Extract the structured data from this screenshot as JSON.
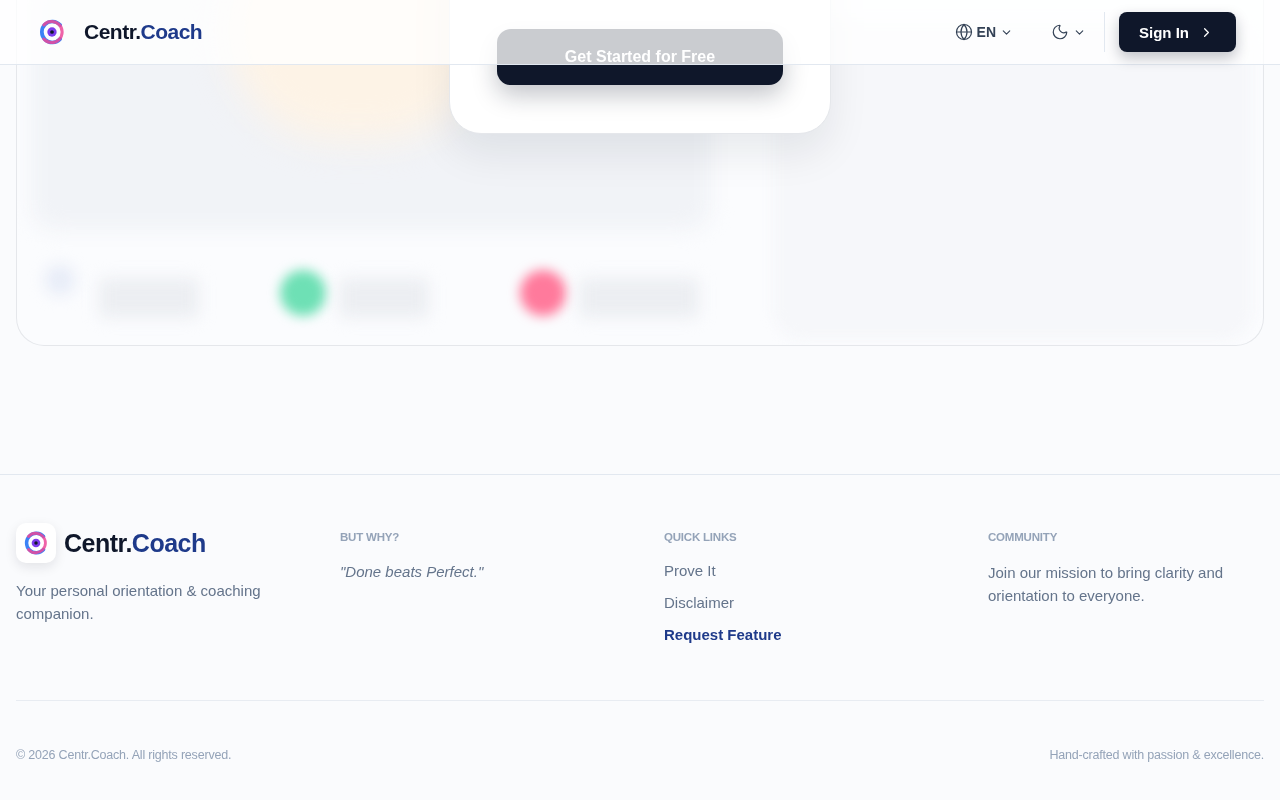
{
  "header": {
    "brand": {
      "prefix": "Centr.",
      "suffix": "Coach"
    },
    "language": "EN",
    "dark_mode": false,
    "sign_in": "Sign In"
  },
  "hero": {
    "cta": "Get Started for Free"
  },
  "footer": {
    "brand": {
      "prefix": "Centr.",
      "suffix": "Coach"
    },
    "tagline": "Your personal orientation & coaching companion.",
    "columns": [
      {
        "kind": "quote",
        "heading": "BUT WHY?",
        "text": "\"Done beats Perfect.\""
      },
      {
        "kind": "links",
        "heading": "QUICK LINKS",
        "links": [
          {
            "label": "Prove It",
            "highlighted": false
          },
          {
            "label": "Disclaimer",
            "highlighted": false
          },
          {
            "label": "Request Feature",
            "highlighted": true
          }
        ]
      },
      {
        "kind": "text",
        "heading": "COMMUNITY",
        "text": "Join our mission to bring clarity and orientation to everyone."
      }
    ],
    "copyright": "© 2026 Centr.Coach. All rights reserved.",
    "credit": "Hand-crafted with passion & excellence."
  }
}
